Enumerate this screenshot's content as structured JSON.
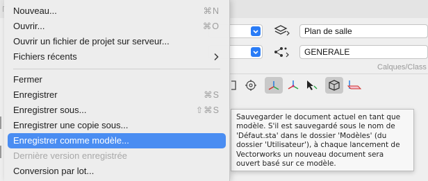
{
  "menu": {
    "items": [
      {
        "label": "Nouveau...",
        "shortcut": "⌘N"
      },
      {
        "label": "Ouvrir...",
        "shortcut": "⌘O"
      },
      {
        "label": "Ouvrir un fichier de projet sur serveur..."
      },
      {
        "label": "Fichiers récents",
        "submenu_icon": "chevron-right-icon"
      },
      {
        "label": "Fermer"
      },
      {
        "label": "Enregistrer",
        "shortcut": "⌘S"
      },
      {
        "label": "Enregistrer sous...",
        "shortcut": "⇧⌘S"
      },
      {
        "label": "Enregistrer une copie sous..."
      },
      {
        "label": "Enregistrer comme modèle...",
        "state": "highlighted"
      },
      {
        "label": "Dernière version enregistrée",
        "state": "disabled"
      },
      {
        "label": "Conversion par lot..."
      }
    ]
  },
  "tooltip": {
    "text": "Sauvegarder le document actuel en tant que modèle. S'il est sauvegardé sous le nom de 'Défaut.sta' dans le dossier 'Modèles' (du dossier 'Utilisateur'), à chaque lancement de Vectorworks un nouveau document sera ouvert basé sur ce modèle."
  },
  "background": {
    "layer_field": "Plan de salle",
    "class_field": "GENERALE",
    "caption": "Calques/Class"
  },
  "colors": {
    "highlight": "#4a8df2",
    "accent": "#2a7cf6"
  }
}
